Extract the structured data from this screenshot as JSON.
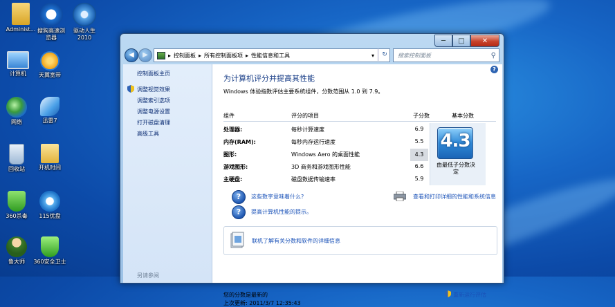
{
  "desktop": {
    "icons": [
      {
        "label": "Administ..."
      },
      {
        "label": "搜狗高速浏\n览器"
      },
      {
        "label": "驱动人生\n2010"
      },
      {
        "label": "计算机"
      },
      {
        "label": "天翼宽带"
      },
      {
        "label": "网络"
      },
      {
        "label": "迅雷7"
      },
      {
        "label": "回收站"
      },
      {
        "label": "开机时间"
      },
      {
        "label": "360杀毒"
      },
      {
        "label": "115优盘"
      },
      {
        "label": "鲁大师"
      },
      {
        "label": "360安全卫士"
      }
    ]
  },
  "window": {
    "min_label": "─",
    "max_label": "□",
    "close_label": "✕",
    "address": {
      "crumbs": [
        "控制面板",
        "所有控制面板项",
        "性能信息和工具"
      ],
      "separator": "▸",
      "refresh": "↻",
      "dropdown": "▾"
    },
    "search": {
      "placeholder": "搜索控制面板",
      "icon": "search-icon"
    },
    "sidebar": {
      "items": [
        {
          "label": "控制面板主页"
        },
        {
          "label": "调整视觉效果"
        },
        {
          "label": "调整索引选项"
        },
        {
          "label": "调整电源设置"
        },
        {
          "label": "打开磁盘清理"
        },
        {
          "label": "高级工具"
        }
      ],
      "see_also": "另请参阅"
    },
    "main": {
      "title": "为计算机评分并提高其性能",
      "subtitle": "Windows 体验指数评估主要系统组件，分数范围从 1.0 到 7.9。",
      "columns": [
        "组件",
        "评分的项目",
        "子分数",
        "基本分数"
      ],
      "rows": [
        {
          "component": "处理器:",
          "item": "每秒计算速度",
          "score": "6.9"
        },
        {
          "component": "内存(RAM):",
          "item": "每秒内存运行速度",
          "score": "5.5"
        },
        {
          "component": "图形:",
          "item": "Windows Aero 的桌面性能",
          "score": "4.3"
        },
        {
          "component": "游戏图形:",
          "item": "3D 商务和游戏图形性能",
          "score": "6.6"
        },
        {
          "component": "主硬盘:",
          "item": "磁盘数据传输速率",
          "score": "5.9"
        }
      ],
      "base_score": "4.3",
      "base_caption": "由最低子分数决\n定",
      "links": {
        "what_mean": "这些数字意味着什么?",
        "tips": "提高计算机性能的提示。",
        "print": "查看和打印详细的性能和系统信息",
        "online": "联机了解有关分数和软件的详细信息",
        "rerun": "重新运行评估"
      },
      "footer": {
        "status": "您的分数是最新的",
        "last_update": "上次更新: 2011/3/7 12:35:43"
      }
    }
  }
}
